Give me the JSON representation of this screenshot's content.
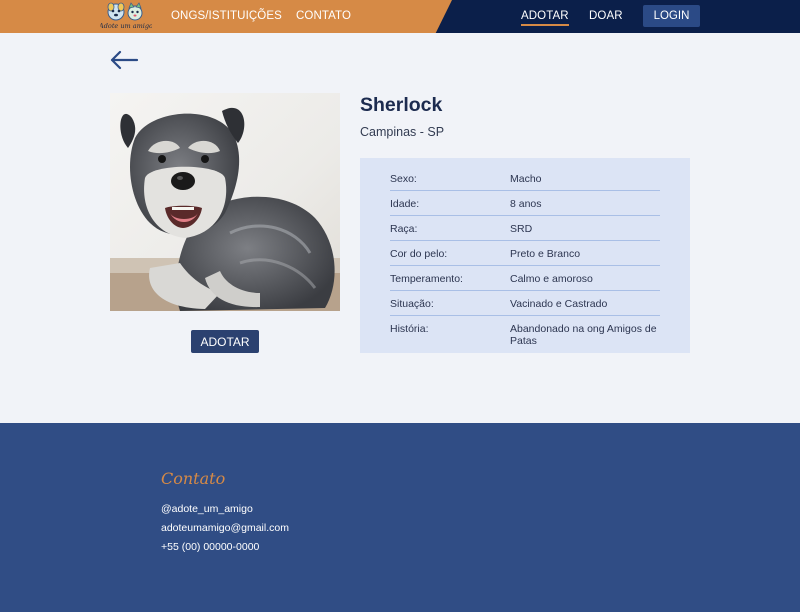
{
  "header": {
    "logo_text": "Adote um amigo",
    "nav_left": [
      {
        "label": "ONGS/ISTITUIÇÕES"
      },
      {
        "label": "CONTATO"
      }
    ],
    "nav_right": [
      {
        "label": "ADOTAR",
        "active": true
      },
      {
        "label": "DOAR"
      }
    ],
    "login_label": "LOGIN"
  },
  "pet": {
    "name": "Sherlock",
    "location": "Campinas - SP",
    "adopt_label": "ADOTAR",
    "details": [
      {
        "label": "Sexo:",
        "value": "Macho"
      },
      {
        "label": "Idade:",
        "value": "8 anos"
      },
      {
        "label": "Raça:",
        "value": "SRD"
      },
      {
        "label": "Cor do pelo:",
        "value": "Preto e Branco"
      },
      {
        "label": "Temperamento:",
        "value": "Calmo e amoroso"
      },
      {
        "label": "Situação:",
        "value": "Vacinado e Castrado"
      },
      {
        "label": "História:",
        "value": "Abandonado na ong Amigos de Patas"
      }
    ]
  },
  "footer": {
    "title": "Contato",
    "instagram": "@adote_um_amigo",
    "email": "adoteumamigo@gmail.com",
    "phone": "+55 (00) 00000-0000"
  },
  "colors": {
    "header_orange": "#d68a46",
    "header_navy": "#0b1f4a",
    "footer_blue": "#304d85",
    "panel_bg": "#dce4f5",
    "page_bg": "#f1f3f8"
  },
  "icons": {
    "back": "arrow-left-icon",
    "logo": "logo-icon"
  }
}
